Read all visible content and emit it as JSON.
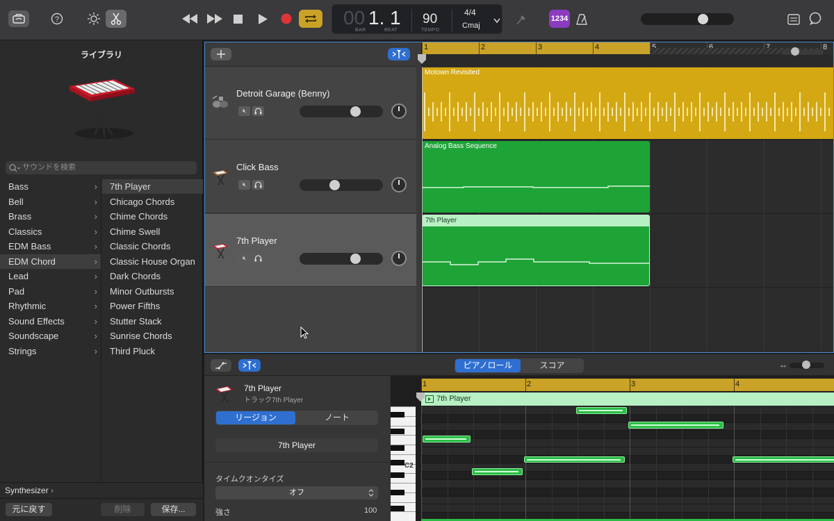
{
  "toolbar": {
    "lcd": {
      "bar": "00",
      "beat_value": "1. 1",
      "bar_label": "BAR",
      "beat_label": "BEAT",
      "tempo": "90",
      "tempo_label": "TEMPO",
      "time_sig": "4/4",
      "key": "Cmaj"
    },
    "count_in": "1234",
    "colors": {
      "accent_loop": "#c9a227",
      "record": "#e0343a",
      "count_in": "#8b3bbf"
    }
  },
  "library": {
    "title": "ライブラリ",
    "search_placeholder": "サウンドを検索",
    "categories": [
      "Bass",
      "Bell",
      "Brass",
      "Classics",
      "EDM Bass",
      "EDM Chord",
      "Lead",
      "Pad",
      "Rhythmic",
      "Sound Effects",
      "Soundscape",
      "Strings"
    ],
    "selected_category": "EDM Chord",
    "patches": [
      "7th Player",
      "Chicago Chords",
      "Chime Chords",
      "Chime Swell",
      "Classic Chords",
      "Classic House Organ",
      "Dark Chords",
      "Minor Outbursts",
      "Power Fifths",
      "Stutter Stack",
      "Sunrise Chords",
      "Third Pluck"
    ],
    "selected_patch": "7th Player",
    "footer_path": "Synthesizer",
    "revert_label": "元に戻す",
    "delete_label": "削除",
    "save_label": "保存..."
  },
  "tracks": [
    {
      "name": "Detroit Garage (Benny)",
      "region": "Motown Revisited",
      "volume": 0.71,
      "color": "#d4a813"
    },
    {
      "name": "Click Bass",
      "region": "Analog Bass Sequence",
      "volume": 0.42,
      "color": "#1ea337"
    },
    {
      "name": "7th Player",
      "region": "7th Player",
      "volume": 0.71,
      "color": "#1ea337"
    }
  ],
  "ruler_bars": [
    "1",
    "2",
    "3",
    "4",
    "5",
    "6",
    "7",
    "8"
  ],
  "editor": {
    "tabs": [
      "ピアノロール",
      "スコア"
    ],
    "active_tab": "ピアノロール",
    "track_name": "7th Player",
    "track_sub": "トラック7th Player",
    "seg": [
      "リージョン",
      "ノート"
    ],
    "region_name": "7th Player",
    "quantize_label": "タイムクオンタイズ",
    "quantize_value": "オフ",
    "strength_label": "強さ",
    "strength_value": "100",
    "ruler_bars": [
      "1",
      "2",
      "3",
      "4"
    ],
    "region_label": "7th Player",
    "key_label": "C2"
  }
}
